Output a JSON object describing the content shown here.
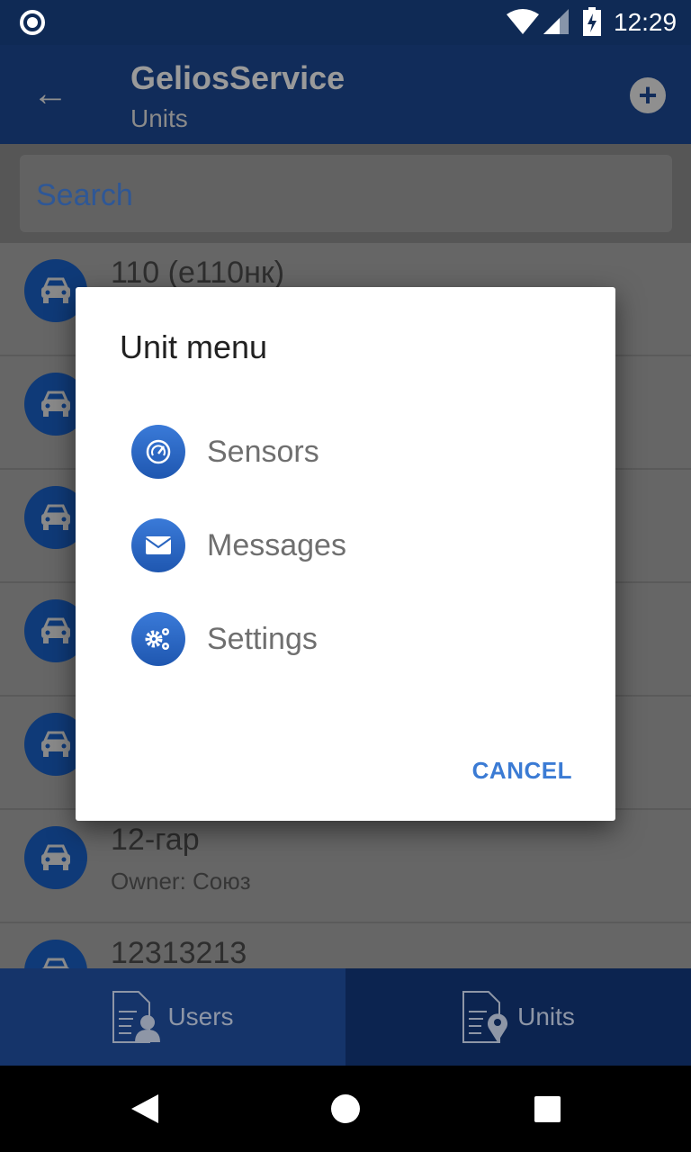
{
  "status_bar": {
    "time": "12:29"
  },
  "app_bar": {
    "title": "GeliosService",
    "subtitle": "Units"
  },
  "search": {
    "placeholder": "Search"
  },
  "units": [
    {
      "name": "110 (е110нк)",
      "owner": ""
    },
    {
      "name": "",
      "owner": ""
    },
    {
      "name": "",
      "owner": ""
    },
    {
      "name": "",
      "owner": ""
    },
    {
      "name": "",
      "owner": ""
    },
    {
      "name": "12-гар",
      "owner": "Owner: Союз"
    },
    {
      "name": "12313213",
      "owner": ""
    }
  ],
  "bottom_nav": {
    "tabs": [
      {
        "label": "Users",
        "icon": "user-document-icon"
      },
      {
        "label": "Units",
        "icon": "location-document-icon",
        "active": true
      }
    ]
  },
  "dialog": {
    "title": "Unit menu",
    "items": [
      {
        "label": "Sensors",
        "icon": "gauge-icon"
      },
      {
        "label": "Messages",
        "icon": "envelope-icon"
      },
      {
        "label": "Settings",
        "icon": "gears-icon"
      }
    ],
    "cancel": "CANCEL"
  },
  "colors": {
    "primary": "#2a5fb2",
    "accent": "#3b7bd4"
  }
}
